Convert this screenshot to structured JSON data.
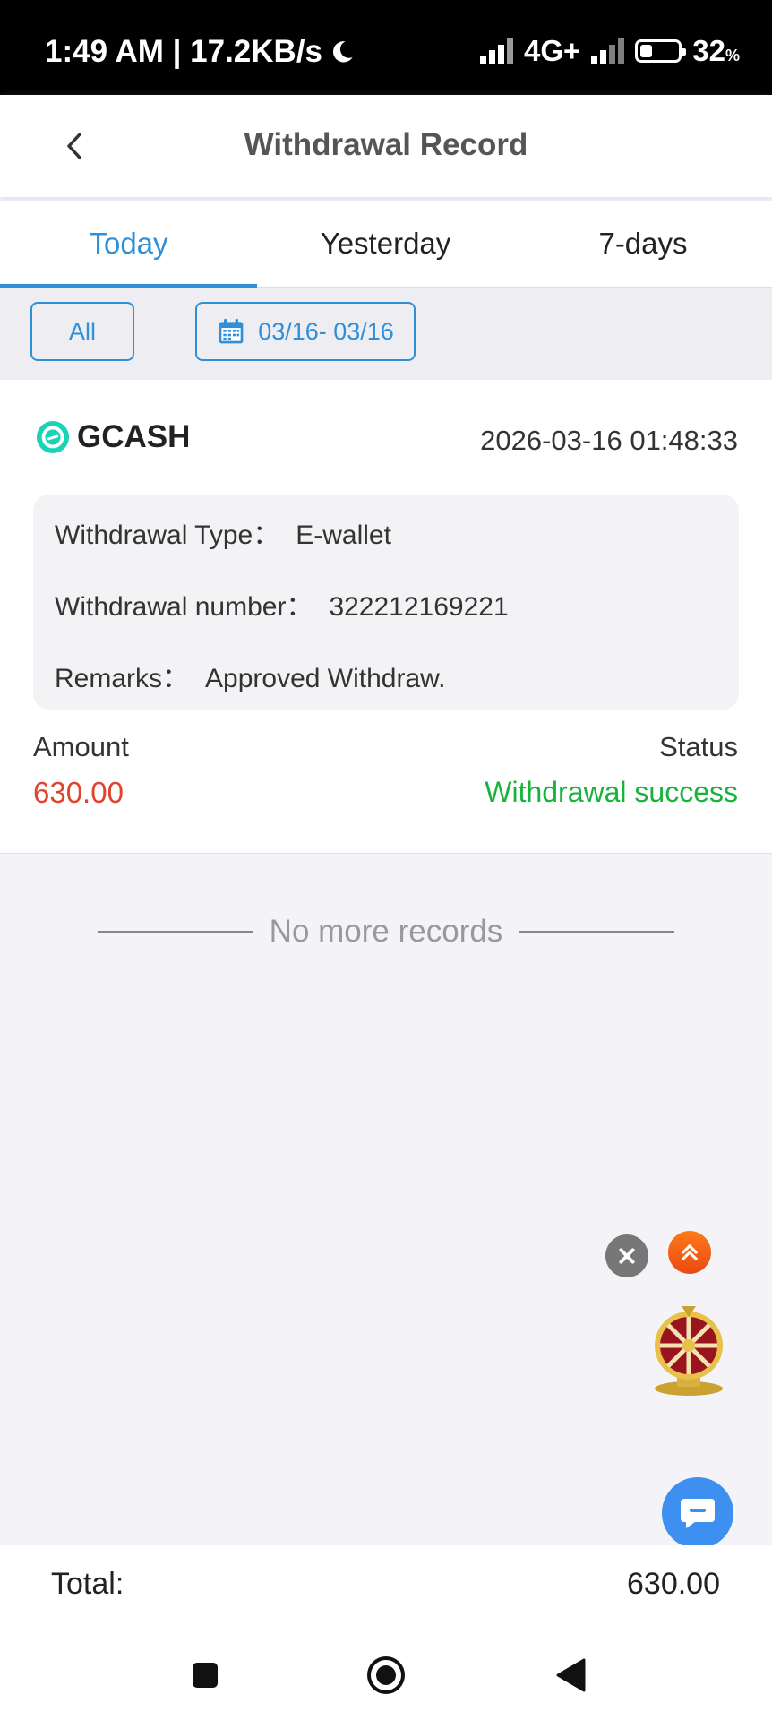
{
  "status_bar": {
    "time_speed": "1:49 AM | 17.2KB/s",
    "network": "4G+",
    "battery": "32",
    "battery_unit": "%",
    "battery_level": 0.32,
    "icons": [
      "moon-icon",
      "signal-icon",
      "signal-icon",
      "battery-icon"
    ]
  },
  "header": {
    "title": "Withdrawal Record",
    "back_icon": "chevron-left-icon"
  },
  "tabs": [
    {
      "label": "Today",
      "active": true
    },
    {
      "label": "Yesterday",
      "active": false
    },
    {
      "label": "7-days",
      "active": false
    }
  ],
  "filters": {
    "type_label": "All",
    "date_range": "03/16- 03/16",
    "date_icon": "calendar-icon"
  },
  "record": {
    "brand": "GCASH",
    "datetime": "2026-03-16 01:48:33",
    "rows": [
      {
        "label": "Withdrawal Type：",
        "value": "E-wallet"
      },
      {
        "label": "Withdrawal number：",
        "value": "322212169221"
      },
      {
        "label": "Remarks：",
        "value": "Approved Withdraw."
      }
    ],
    "amount_label": "Amount",
    "amount": "630.00",
    "status_label": "Status",
    "status": "Withdrawal success"
  },
  "no_more": "No more records",
  "total": {
    "label": "Total:",
    "value": "630.00"
  },
  "colors": {
    "accent": "#2f8fd8",
    "amount": "#e0432e",
    "success": "#18b33c",
    "gcash": "#19d3b8"
  }
}
